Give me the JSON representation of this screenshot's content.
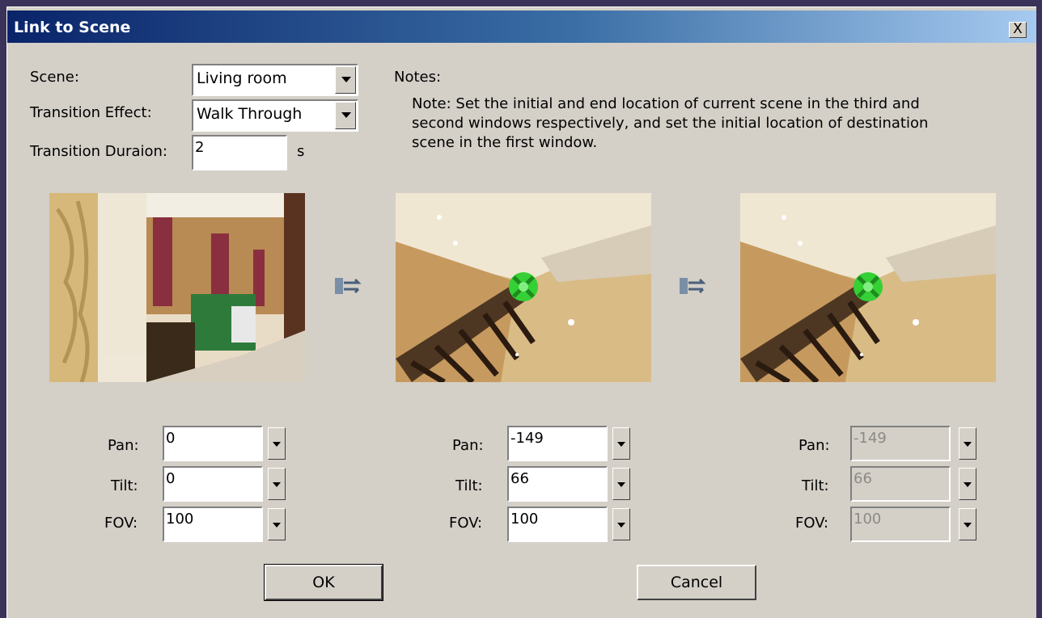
{
  "window": {
    "title": "Link to Scene",
    "close_label": "X"
  },
  "form": {
    "scene_label": "Scene:",
    "scene_value": "Living room",
    "transition_label": "Transition Effect:",
    "transition_value": "Walk Through",
    "duration_label": "Transition Duraion:",
    "duration_value": "2",
    "duration_unit": "s"
  },
  "notes": {
    "heading": "Notes:",
    "lines": [
      "Note: Set the initial and end location of current scene in the third and",
      "second windows respectively, and set the initial location of destination",
      "scene in the first window."
    ]
  },
  "views": [
    {
      "pan_label": "Pan:",
      "tilt_label": "Tilt:",
      "fov_label": "FOV:",
      "pan": "0",
      "tilt": "0",
      "fov": "100",
      "enabled": true
    },
    {
      "pan_label": "Pan:",
      "tilt_label": "Tilt:",
      "fov_label": "FOV:",
      "pan": "-149",
      "tilt": "66",
      "fov": "100",
      "enabled": true
    },
    {
      "pan_label": "Pan:",
      "tilt_label": "Tilt:",
      "fov_label": "FOV:",
      "pan": "-149",
      "tilt": "66",
      "fov": "100",
      "enabled": false
    }
  ],
  "icons": {
    "swap": "swap-arrows-icon",
    "hotspot": "hotspot-target-icon",
    "dropdown": "dropdown-arrow-icon"
  },
  "buttons": {
    "ok": "OK",
    "cancel": "Cancel"
  },
  "colors": {
    "titlebar_start": "#0a246a",
    "titlebar_end": "#a6caf0",
    "dialog_bg": "#d4d0c8",
    "hotspot": "#35d035"
  }
}
